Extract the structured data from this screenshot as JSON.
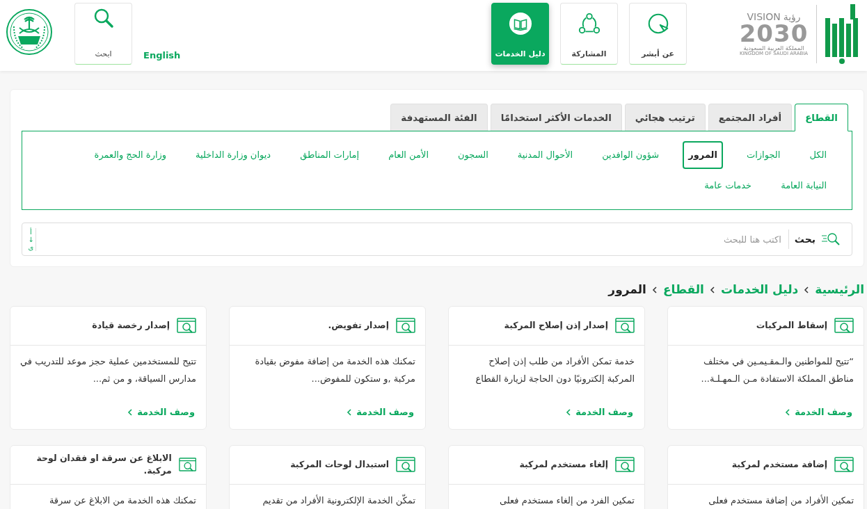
{
  "header": {
    "vision_logo": {
      "word_en": "VISION",
      "word_ar": "رؤية",
      "year": "2030",
      "country_ar": "المملكة العربية السعودية",
      "country_en": "KINGDOM OF SAUDI ARABIA"
    },
    "nav": [
      {
        "label": "عن أبشر",
        "kind": "pointer",
        "selected": false
      },
      {
        "label": "المشاركة",
        "kind": "share",
        "selected": false
      },
      {
        "label": "دليل الخدمات",
        "kind": "book",
        "selected": true
      }
    ],
    "language_link": "English",
    "search_button": "ابحث"
  },
  "tabs": [
    {
      "label": "القطاع",
      "selected": true
    },
    {
      "label": "أفراد المجتمع",
      "selected": false
    },
    {
      "label": "ترتيب هجائي",
      "selected": false
    },
    {
      "label": "الخدمات الأكثر استخدامًا",
      "selected": false
    },
    {
      "label": "الفئة المستهدفة",
      "selected": false
    }
  ],
  "filters": [
    {
      "label": "الكل",
      "selected": false
    },
    {
      "label": "الجوازات",
      "selected": false
    },
    {
      "label": "المرور",
      "selected": true
    },
    {
      "label": "شؤون الوافدين",
      "selected": false
    },
    {
      "label": "الأحوال المدنية",
      "selected": false
    },
    {
      "label": "السجون",
      "selected": false
    },
    {
      "label": "الأمن العام",
      "selected": false
    },
    {
      "label": "إمارات المناطق",
      "selected": false
    },
    {
      "label": "ديوان وزارة الداخلية",
      "selected": false
    },
    {
      "label": "وزارة الحج والعمرة",
      "selected": false
    },
    {
      "label": "النيابة العامة",
      "selected": false
    },
    {
      "label": "خدمات عامة",
      "selected": false
    }
  ],
  "search": {
    "label": "بحث",
    "placeholder": "اكتب هنا للبحث",
    "sort": [
      "أ",
      "↓",
      "ى"
    ]
  },
  "breadcrumb": [
    {
      "label": "الرئيسية",
      "current": false
    },
    {
      "label": "دليل الخدمات",
      "current": false
    },
    {
      "label": "القطاع",
      "current": false
    },
    {
      "label": "المرور",
      "current": true
    }
  ],
  "cards": [
    {
      "title": "إسقاط المركبات",
      "description": "“تتيح للمواطنين والـمقـيمـين في مختلف مناطق المملكة الاستفادة مـن الـمهـلـة...",
      "link": "وصف الخدمة"
    },
    {
      "title": "إصدار إذن إصلاح المركبة",
      "description": "خدمة تمكن الأفراد من طلب إذن إصلاح المركبة إلكترونيًا دون الحاجة لزيارة القطاع",
      "link": "وصف الخدمة"
    },
    {
      "title": "إصدار تفويض.",
      "description": "تمكنك هذه الخدمة من إضافة مفوض بقيادة مركبة ,و ستكون للمفوض...",
      "link": "وصف الخدمة"
    },
    {
      "title": "إصدار رخصة قيادة",
      "description": "تتيح للمستخدمين عملية حجز موعد للتدريب في مدارس السياقة، و من ثم...",
      "link": "وصف الخدمة"
    },
    {
      "title": "إضافة مستخدم لمركبة",
      "description": "تمكين الأفراد من إضافة مستخدم فعلى"
    },
    {
      "title": "إلغاء مستخدم لمركبة",
      "description": "تمكين الفرد من إلغاء مستخدم فعلى"
    },
    {
      "title": "استبدال لوحات المركبة",
      "description": "تمكّن الخدمة الإلكترونية الأفراد من تقديم"
    },
    {
      "title": "الابلاغ عن سرقة او فقدان لوحة مركبة.",
      "description": "تمكنك هذه الخدمة من الابلاغ عن سرقة"
    }
  ]
}
